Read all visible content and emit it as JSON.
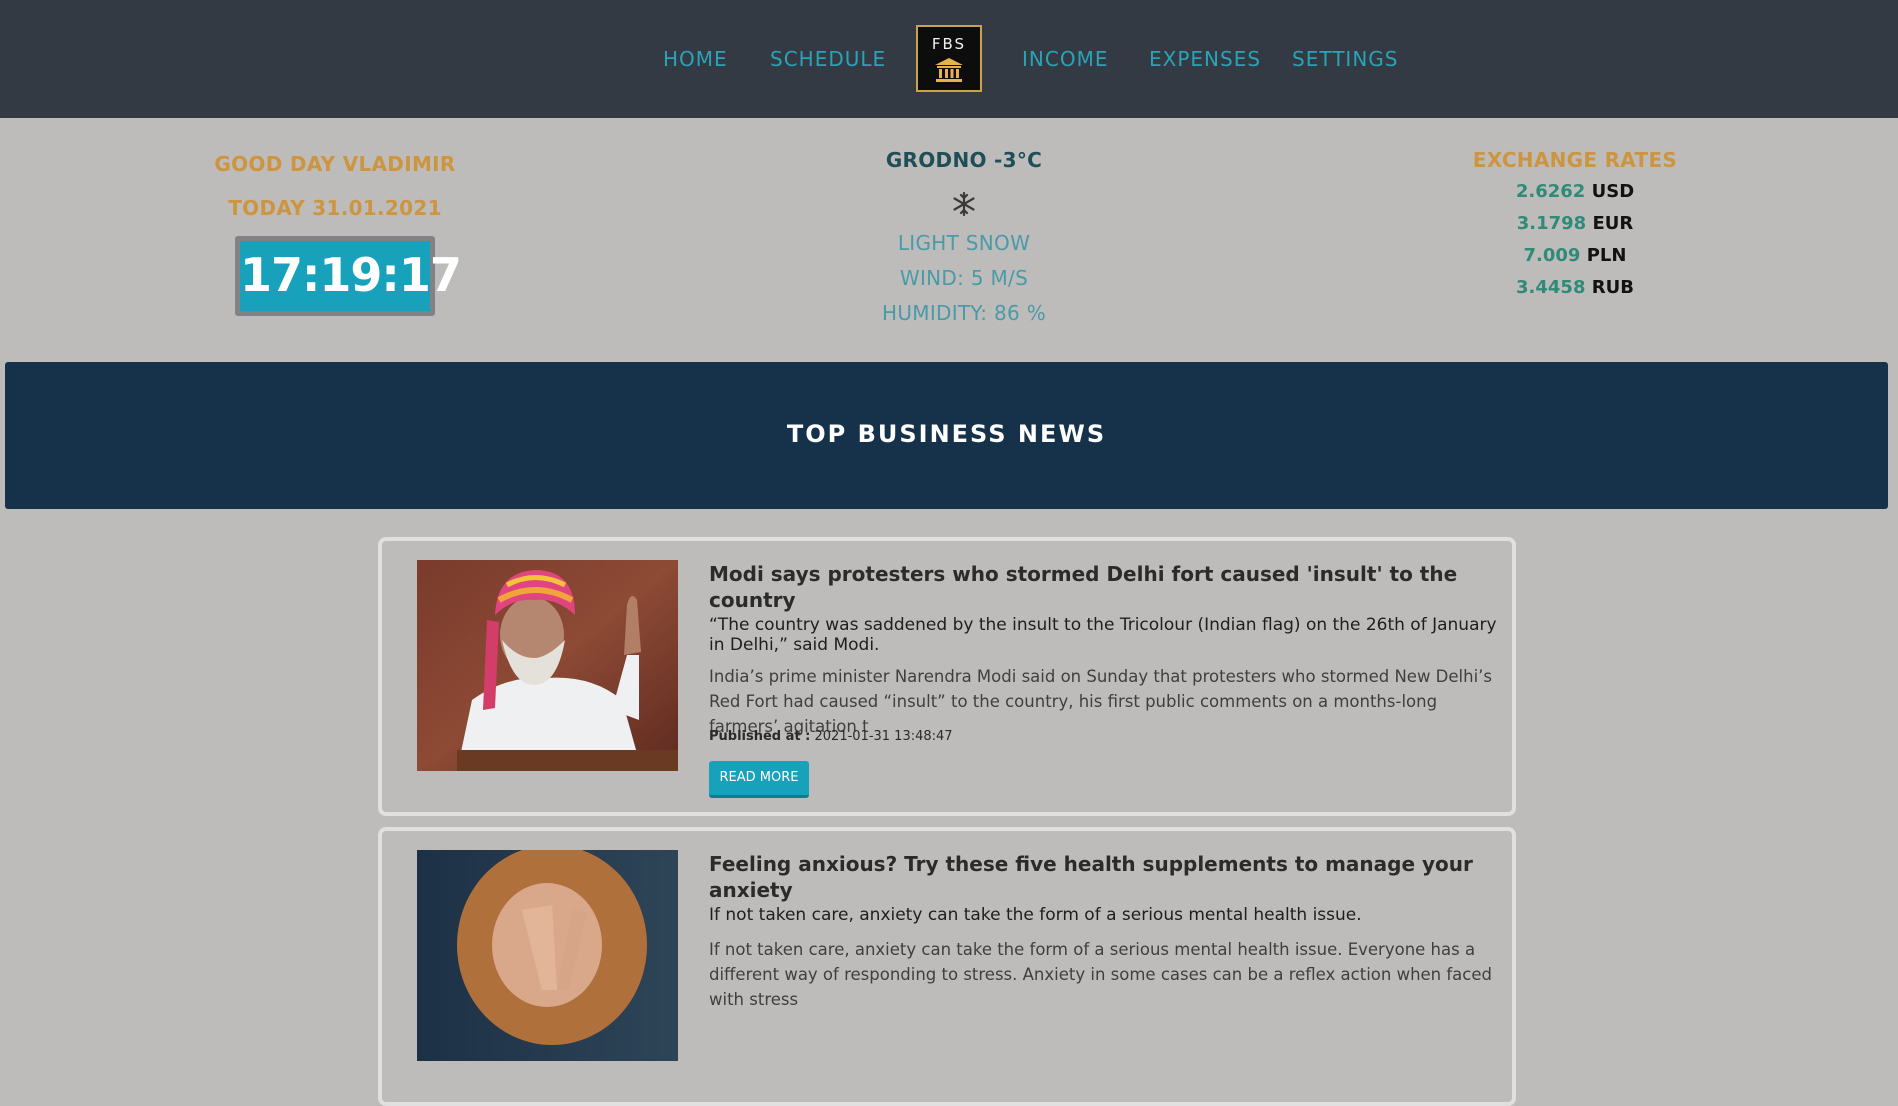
{
  "nav": {
    "home": "HOME",
    "schedule": "SCHEDULE",
    "income": "INCOME",
    "expenses": "EXPENSES",
    "settings": "SETTINGS",
    "logo_text": "FBS",
    "logo_icon": "bank-icon"
  },
  "greeting": {
    "hello": "GOOD DAY VLADIMIR",
    "today": "TODAY 31.01.2021",
    "clock": "17:19:17"
  },
  "weather": {
    "city": "GRODNO -3°C",
    "icon": "snowflake-icon",
    "condition": "LIGHT SNOW",
    "wind": "WIND: 5 M/S",
    "humidity": "HUMIDITY: 86 %"
  },
  "rates": {
    "title": "EXCHANGE RATES",
    "items": [
      {
        "value": "2.6262",
        "currency": "USD"
      },
      {
        "value": "3.1798",
        "currency": "EUR"
      },
      {
        "value": "7.009",
        "currency": "PLN"
      },
      {
        "value": "3.4458",
        "currency": "RUB"
      }
    ]
  },
  "banner": {
    "title": "TOP BUSINESS NEWS"
  },
  "news": [
    {
      "title": "Modi says protesters who stormed Delhi fort caused 'insult' to the country",
      "description": "“The country was saddened by the insult to the Tricolour (Indian flag) on the 26th of January in Delhi,” said Modi.",
      "content": "India’s prime minister Narendra Modi said on Sunday that protesters who stormed New Delhi’s Red Fort had caused “insult” to the country, his first public comments on a months-long farmers’ agitation t",
      "published_label": "Published at :",
      "published_at": "2021-01-31 13:48:47",
      "button": "READ MORE"
    },
    {
      "title": "Feeling anxious? Try these five health supplements to manage your anxiety",
      "description": "If not taken care, anxiety can take the form of a serious mental health issue.",
      "content": "If not taken care, anxiety can take the form of a serious mental health issue. Everyone has a different way of responding to stress. Anxiety in some cases can be a reflex action when faced with stress",
      "published_label": "",
      "published_at": "",
      "button": ""
    }
  ],
  "colors": {
    "navbar": "#343a43",
    "nav_link": "#2aa3b7",
    "page_bg": "#bdbcbb",
    "accent_gold": "#cd953f",
    "clock_bg": "#18a1bb",
    "banner_bg": "#15324a",
    "rate_value": "#2f8a78"
  }
}
